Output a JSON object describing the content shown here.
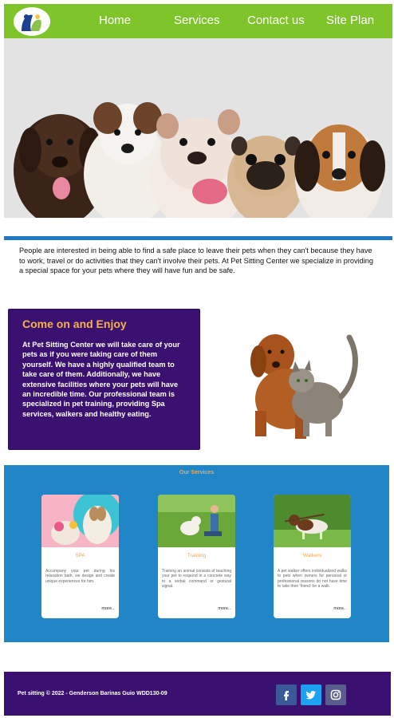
{
  "header": {
    "logo_icon": "pets-logo-icon",
    "nav": [
      "Home",
      "Services",
      "Contact us",
      "Site Plan"
    ]
  },
  "hero": {
    "image": "group-of-puppies-photo"
  },
  "intro": {
    "text": "People are interested in being able to find a safe place to leave their pets when they can't because they have to work, travel or do activities that they can't involve their pets. At Pet Sitting Center we specialize in providing a special space for your pets where they will have fun and be safe."
  },
  "enjoy": {
    "title": "Come on and Enjoy",
    "text": "At Pet Sitting Center we will take care of your pets as if you were taking care of them yourself. We have a highly qualified team to take care of them. Additionally, we have extensive facilities where your pets will have an incredible time. Our professional team is specialized in pet training, providing Spa services, walkers and healthy eating.",
    "image": "dog-and-cat-photo"
  },
  "services": {
    "title": "Our Services",
    "cards": [
      {
        "title": "SPA",
        "text": "Accompany your pet during his relaxation bath, we design and create unique experiences for him.",
        "more": "more..",
        "image": "groomed-dog-photo"
      },
      {
        "title": "Training",
        "text": "Training an animal consists of teaching your pet to respond in a concrete way to a verbal command or gestural signal.",
        "more": "more..",
        "image": "dog-training-photo"
      },
      {
        "title": "Walkers",
        "text": "A pet walker offers individualized walks to pets when owners for personal or professional reasons do not have time to take their 'friend' for a walk.",
        "more": "more..",
        "image": "dog-walking-photo"
      }
    ]
  },
  "footer": {
    "copyright": "Pet sitting © 2022 - Genderson Barinas Guio WDD130-09",
    "social": [
      {
        "icon": "facebook-icon",
        "color": "#3b5998"
      },
      {
        "icon": "twitter-icon",
        "color": "#1da1f2"
      },
      {
        "icon": "instagram-icon",
        "color": "#5a5e8e"
      }
    ]
  },
  "colors": {
    "header_green": "#7ec42a",
    "accent_blue": "#2186c8",
    "purple": "#3a1170",
    "orange": "#f3a64a"
  }
}
